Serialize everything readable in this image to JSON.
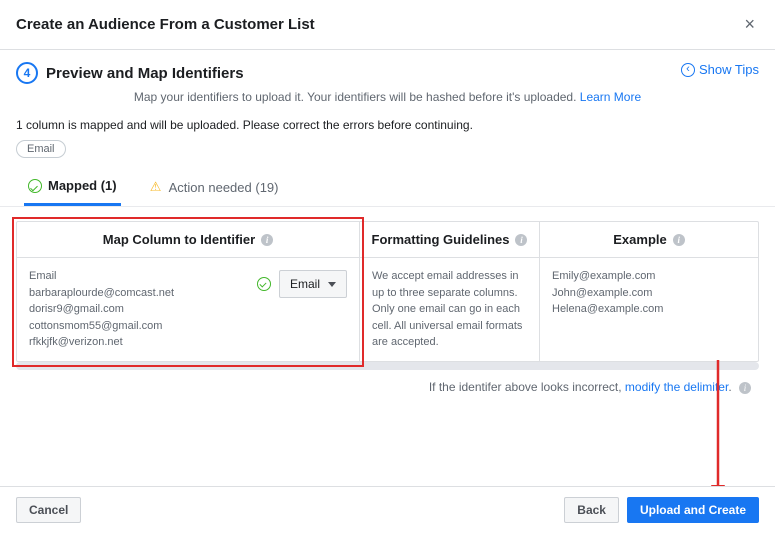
{
  "header": {
    "title": "Create an Audience From a Customer List"
  },
  "step": {
    "number": "4",
    "title": "Preview and Map Identifiers",
    "subtext_prelink": "Map your identifiers to upload it. Your identifiers will be hashed before it's uploaded. ",
    "subtext_link": "Learn More",
    "show_tips": "Show Tips"
  },
  "warning": "1 column is mapped and will be uploaded. Please correct the errors before continuing.",
  "pill": "Email",
  "tabs": {
    "mapped_label": "Mapped (1)",
    "action_label": "Action needed (19)"
  },
  "columns": {
    "map_header": "Map Column to Identifier",
    "format_header": "Formatting Guidelines",
    "example_header": "Example",
    "map": {
      "label": "Email",
      "samples": [
        "barbaraplourde@comcast.net",
        "dorisr9@gmail.com",
        "cottonsmom55@gmail.com",
        "rfkkjfk@verizon.net"
      ],
      "dropdown": "Email"
    },
    "format_text": "We accept email addresses in up to three separate columns. Only one email can go in each cell. All universal email formats are accepted.",
    "example_list": [
      "Emily@example.com",
      "John@example.com",
      "Helena@example.com"
    ]
  },
  "delimiter": {
    "pretext": "If the identifer above looks incorrect, ",
    "link": "modify the delimiter",
    "post": "."
  },
  "footer": {
    "cancel": "Cancel",
    "back": "Back",
    "upload": "Upload and Create"
  }
}
